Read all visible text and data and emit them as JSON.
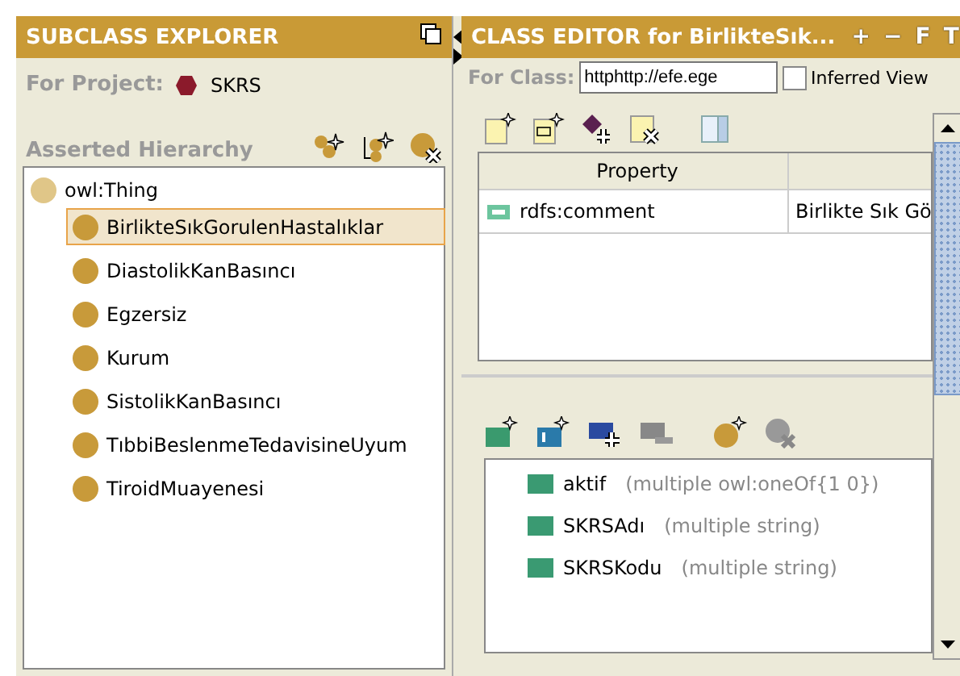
{
  "subclass_explorer": {
    "title": "SUBCLASS EXPLORER",
    "project_label": "For Project:",
    "project": "SKRS",
    "hierarchy_label": "Asserted Hierarchy",
    "tree": [
      {
        "label": "owl:Thing",
        "selected": false,
        "children": [
          {
            "label": "BirlikteSıkGorulenHastalıklar",
            "selected": true
          },
          {
            "label": "DiastolikKanBasıncı",
            "selected": false
          },
          {
            "label": "Egzersiz",
            "selected": false
          },
          {
            "label": "Kurum",
            "selected": false
          },
          {
            "label": "SistolikKanBasıncı",
            "selected": false
          },
          {
            "label": "TıbbiBeslenmeTedavisineUyum",
            "selected": false
          },
          {
            "label": "TiroidMuayenesi",
            "selected": false
          }
        ]
      }
    ]
  },
  "class_editor": {
    "title": "CLASS EDITOR for BirlikteSık...",
    "header_buttons": [
      "+",
      "−",
      "F",
      "T"
    ],
    "class_label": "For Class:",
    "class_value": "httphttp://efe.ege",
    "inferred_view": {
      "label": "Inferred View",
      "checked": false
    },
    "table": {
      "columns": [
        "Property"
      ],
      "rows": [
        {
          "property": "rdfs:comment",
          "value": "Birlikte Sık Gö"
        }
      ]
    },
    "slots": [
      {
        "name": "aktif",
        "type": "(multiple owl:oneOf{1 0})"
      },
      {
        "name": "SKRSAdı",
        "type": "(multiple string)"
      },
      {
        "name": "SKRSKodu",
        "type": "(multiple string)"
      }
    ]
  }
}
